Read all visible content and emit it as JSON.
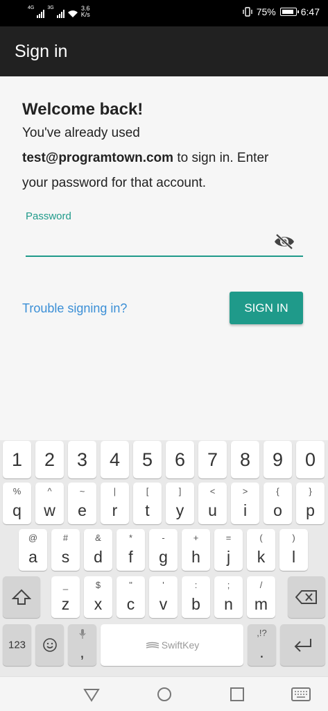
{
  "status_bar": {
    "signal1_label": "4G",
    "signal2_label": "3G",
    "speed_value": "3.6",
    "speed_unit": "K/s",
    "battery": "75%",
    "time": "6:47"
  },
  "app_bar": {
    "title": "Sign in"
  },
  "main": {
    "heading": "Welcome back!",
    "desc_prefix": "You've already used ",
    "email": "test@programtown.com",
    "desc_suffix": " to sign in. Enter your password for that account.",
    "password_label": "Password",
    "password_value": "",
    "trouble_link": "Trouble signing in?",
    "signin_button": "SIGN IN"
  },
  "keyboard": {
    "number_row": [
      "1",
      "2",
      "3",
      "4",
      "5",
      "6",
      "7",
      "8",
      "9",
      "0"
    ],
    "row1": [
      {
        "main": "q",
        "sub": "%"
      },
      {
        "main": "w",
        "sub": "^"
      },
      {
        "main": "e",
        "sub": "~"
      },
      {
        "main": "r",
        "sub": "|"
      },
      {
        "main": "t",
        "sub": "["
      },
      {
        "main": "y",
        "sub": "]"
      },
      {
        "main": "u",
        "sub": "<"
      },
      {
        "main": "i",
        "sub": ">"
      },
      {
        "main": "o",
        "sub": "{"
      },
      {
        "main": "p",
        "sub": "}"
      }
    ],
    "row2": [
      {
        "main": "a",
        "sub": "@"
      },
      {
        "main": "s",
        "sub": "#"
      },
      {
        "main": "d",
        "sub": "&"
      },
      {
        "main": "f",
        "sub": "*"
      },
      {
        "main": "g",
        "sub": "-"
      },
      {
        "main": "h",
        "sub": "+"
      },
      {
        "main": "j",
        "sub": "="
      },
      {
        "main": "k",
        "sub": "("
      },
      {
        "main": "l",
        "sub": ")"
      }
    ],
    "row3": [
      {
        "main": "z",
        "sub": "_"
      },
      {
        "main": "x",
        "sub": "$"
      },
      {
        "main": "c",
        "sub": "\""
      },
      {
        "main": "v",
        "sub": "'"
      },
      {
        "main": "b",
        "sub": ":"
      },
      {
        "main": "n",
        "sub": ";"
      },
      {
        "main": "m",
        "sub": "/"
      }
    ],
    "symbols_key": "123",
    "comma_key": ",",
    "period_key": ".",
    "period_sub": ",!?",
    "space_label": "SwiftKey"
  },
  "colors": {
    "accent": "#1f9a8a",
    "link": "#3b8fd6",
    "app_bar": "#212121"
  }
}
